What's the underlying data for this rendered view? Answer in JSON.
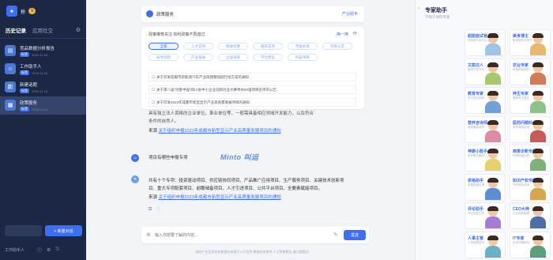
{
  "sidebar": {
    "app_name": "扮",
    "vip_label": "V",
    "tabs": [
      {
        "label": "历史记录"
      },
      {
        "label": "应用社交"
      }
    ],
    "chats": [
      {
        "title": "竞品数据分析报告",
        "tag": "标签",
        "time": "2023-11-18"
      },
      {
        "title": "工作助手人",
        "tag": "标签",
        "time": "2023-11-16"
      },
      {
        "title": "新建话题",
        "tag": "标签",
        "time": "2023-11-15"
      },
      {
        "title": "政策服务",
        "tag": "标签",
        "time": "2023-11-14"
      }
    ],
    "new_button": "+ 新建对话",
    "footer_brand": "工作助手人"
  },
  "main": {
    "header_title": "政策服务",
    "header_link": "产业助手",
    "policy_card": {
      "intro": "政策推荐关注 有利政策不再错过",
      "refresh": "换一换",
      "tags_row1": [
        "全部",
        "人才支持",
        "税收优惠",
        "融资支持",
        "奖励补助",
        "资质认定"
      ],
      "tags_row2": [
        "技术创新",
        "产业发展",
        "企业培育",
        "平台建设",
        "科技项目"
      ],
      "notices": [
        "关于印发成都市新能源汽车产业链建圈强链行动方案的通知",
        "关于第八届“创客中国”四川省中小企业创新创业大赛举办50强项目名单的公告",
        "关于印发2023年成都市新型显示产业高质量发展项目的通知"
      ]
    },
    "para1_lines": [
      "具有独立法人资格的企业单位，事业单位等，一般需具备相应领域开发能力，以及符合",
      "条件的自然人。"
    ],
    "source1_label": "来源",
    "source1_link": "关于组织申报2023年成都市新型显示产业高质量发展项目的通知",
    "user_question": "项目有哪些申报专项",
    "watermark": "Minto 叫运",
    "answer_lines": [
      "共有十个专项：投资驱动项目、供应链协同项目、产品推广应用项目、生产服务项目、关键技术创新项",
      "目、重大专项配套项目、前瞻储备项目、人才引进项目、公共平台项目、全要素赋能项目。"
    ],
    "source2_label": "来源",
    "source2_link": "关于组织申报2023年成都市新型显示产业高质量发展项目的通知",
    "input_placeholder": "输入你想要了解的内容...",
    "send_button": "发送",
    "disclaimer": "政府产业信息发布数据均来源于公开信息  数据仅供参考  人工智能服务  请注意甄别"
  },
  "experts": {
    "title": "专家助手",
    "subtitle": "不限于你的专家",
    "items": [
      {
        "name": "超能面试官",
        "sub": "快速提升面试水平",
        "color": "#9ec5e8"
      },
      {
        "name": "美食博主",
        "sub": "美食推荐与制作",
        "color": "#e9b86c"
      },
      {
        "name": "文案达人",
        "sub": "营销文案写作",
        "color": "#a8c86f"
      },
      {
        "name": "农业专家",
        "sub": "种植养殖指导",
        "color": "#d27a5a"
      },
      {
        "name": "教育专家",
        "sub": "学习成长规划",
        "color": "#6fa1d8"
      },
      {
        "name": "养生专家",
        "sub": "健康养生建议",
        "color": "#8fc28a"
      },
      {
        "name": "营养咨询师",
        "sub": "营养膳食搭配",
        "color": "#e08aa5"
      },
      {
        "name": "医药问题科",
        "sub": "医药健康咨询",
        "color": "#c95a5a"
      },
      {
        "name": "神聊小能手",
        "sub": "陪你聊天解闷",
        "color": "#e8d06a"
      },
      {
        "name": "病害诊断专家",
        "sub": "作物病害诊断",
        "color": "#7bb37b"
      },
      {
        "name": "表格助手",
        "sub": "表格数据处理",
        "color": "#5a8fd6"
      },
      {
        "name": "知识产权专家",
        "sub": "专利商标咨询",
        "color": "#d6a64e"
      },
      {
        "name": "评论助手",
        "sub": "评论回复生成",
        "color": "#a67bd6"
      },
      {
        "name": "CEO大神",
        "sub": "企业经营管理",
        "color": "#4f6fa8"
      },
      {
        "name": "人事主管",
        "sub": "人事管理咨询",
        "color": "#6bb0c9"
      },
      {
        "name": "IT专家",
        "sub": "技术问题解答",
        "color": "#5aa07a"
      }
    ]
  }
}
